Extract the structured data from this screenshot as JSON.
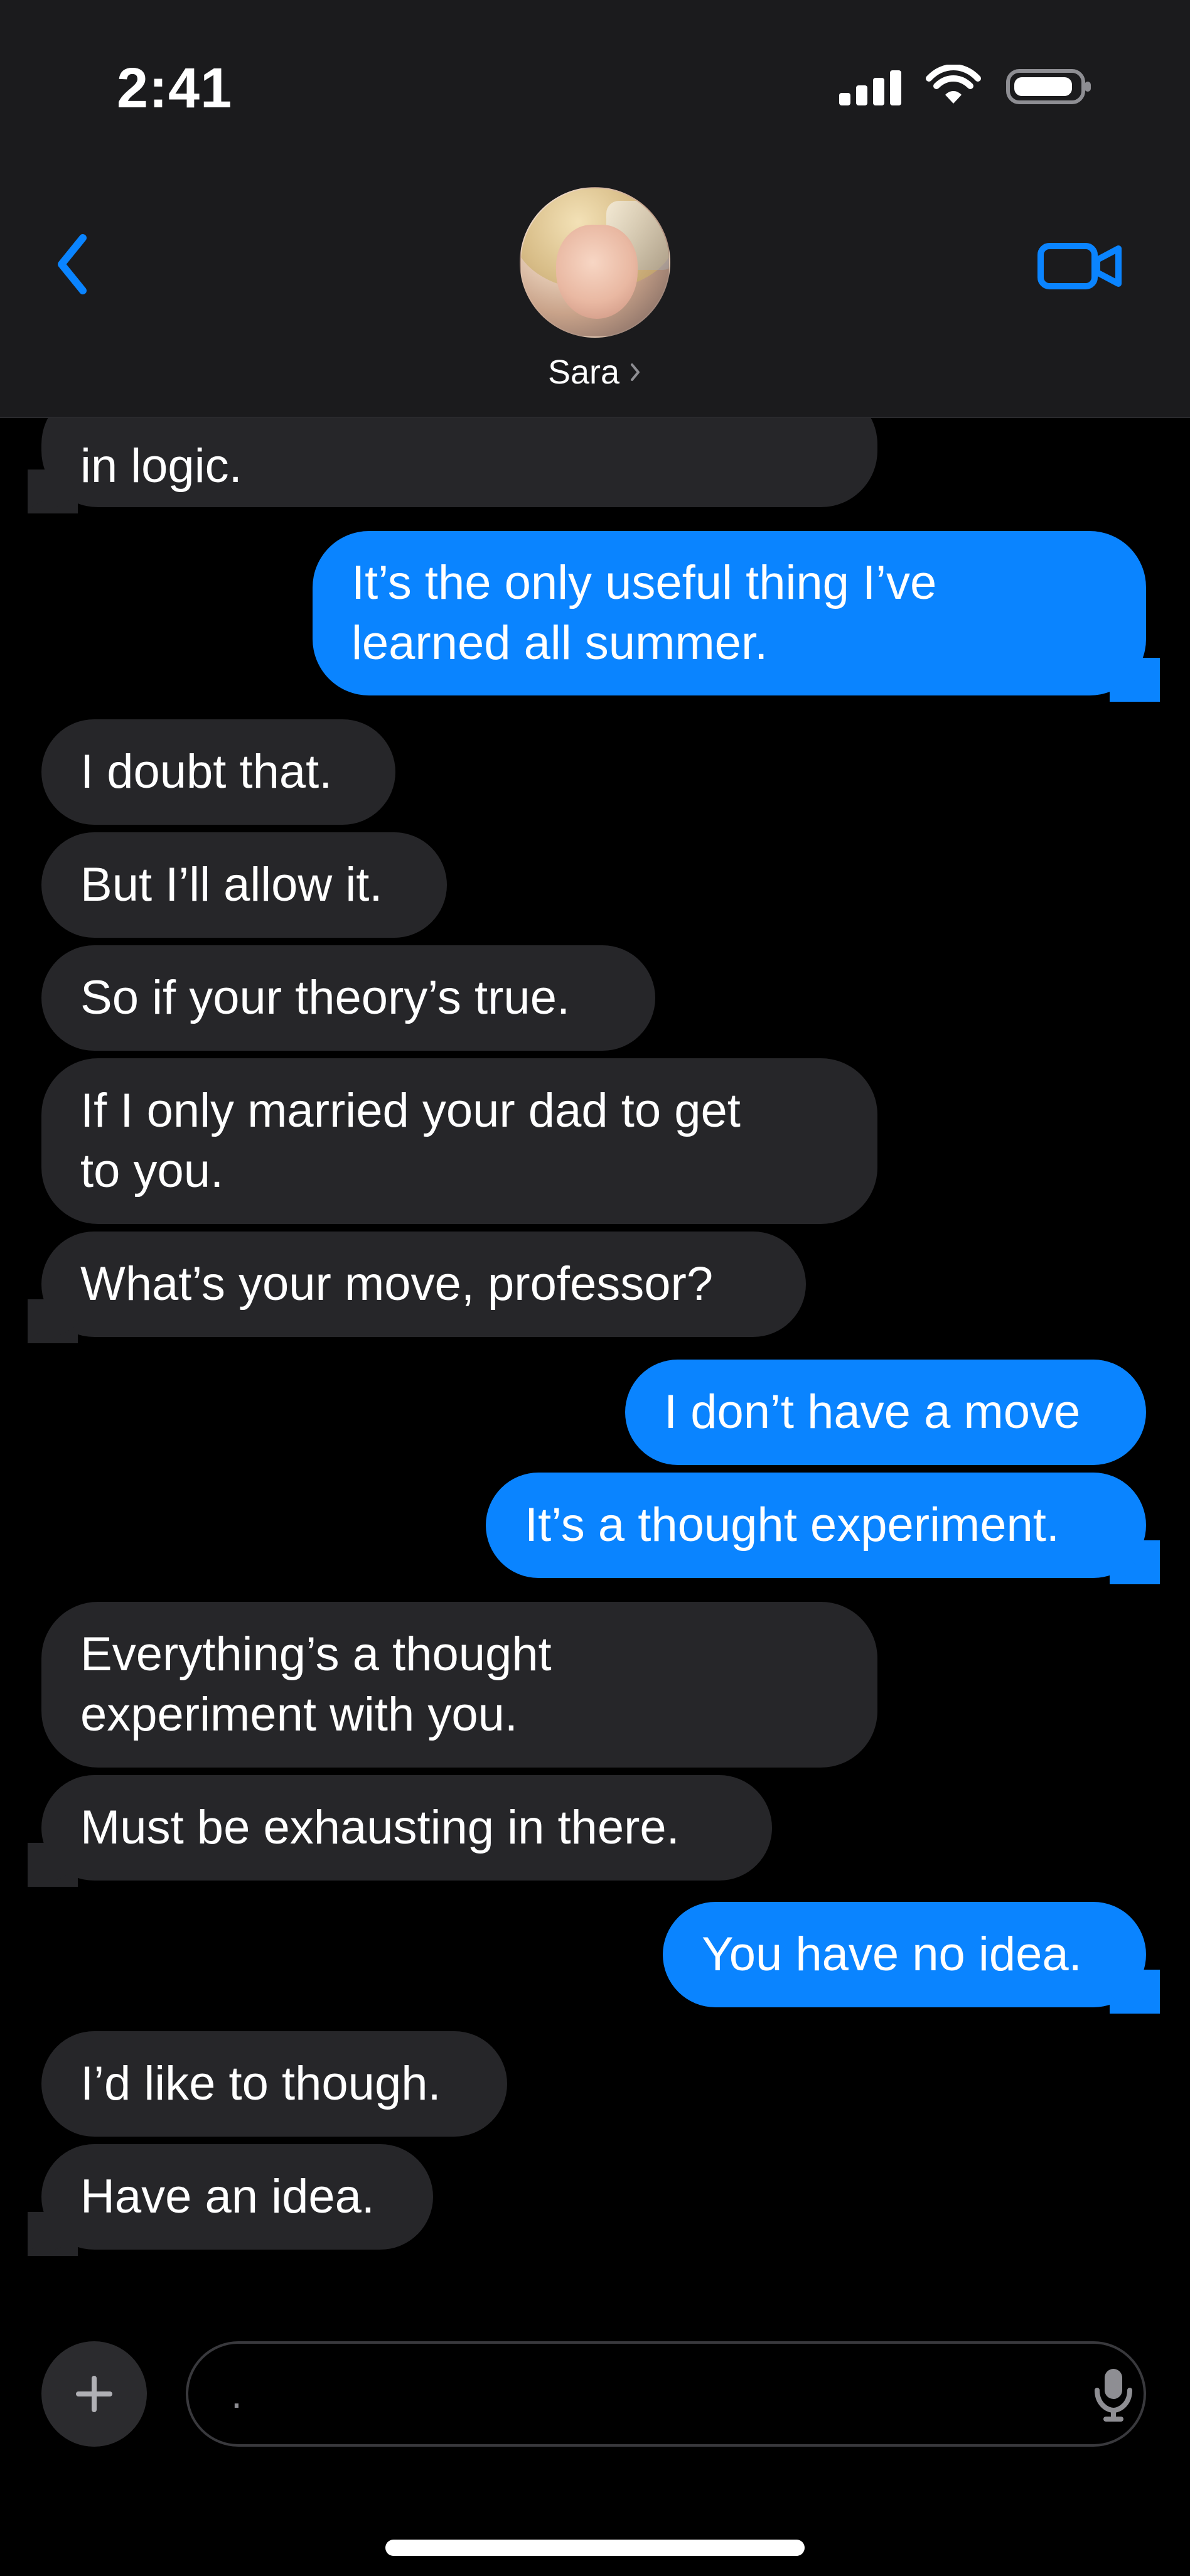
{
  "status": {
    "time": "2:41"
  },
  "header": {
    "contact_name": "Sara",
    "back_icon": "chevron-left-icon",
    "video_icon": "video-call-icon"
  },
  "messages": [
    {
      "dir": "in",
      "text": "in logic."
    },
    {
      "dir": "out",
      "text": "It’s the only useful thing I’ve\nlearned all summer."
    },
    {
      "dir": "in",
      "text": "I doubt that."
    },
    {
      "dir": "in",
      "text": "But I’ll allow it."
    },
    {
      "dir": "in",
      "text": "So if your theory’s true."
    },
    {
      "dir": "in",
      "text": "If I only married your dad to get\nto you."
    },
    {
      "dir": "in",
      "text": "What’s your move, professor?"
    },
    {
      "dir": "out",
      "text": "I don’t have a move"
    },
    {
      "dir": "out",
      "text": "It’s a thought experiment."
    },
    {
      "dir": "in",
      "text": "Everything’s a thought\nexperiment with you."
    },
    {
      "dir": "in",
      "text": "Must be exhausting in there."
    },
    {
      "dir": "out",
      "text": "You have no idea."
    },
    {
      "dir": "in",
      "text": "I’d like to though."
    },
    {
      "dir": "in",
      "text": "Have an idea."
    }
  ],
  "composer": {
    "placeholder": ".",
    "plus_icon": "plus-icon",
    "mic_icon": "microphone-icon"
  },
  "colors": {
    "accent": "#0a84ff",
    "incoming_bubble": "#262629",
    "outgoing_bubble": "#0a84ff",
    "background": "#000000",
    "topbar": "#1b1b1d"
  }
}
